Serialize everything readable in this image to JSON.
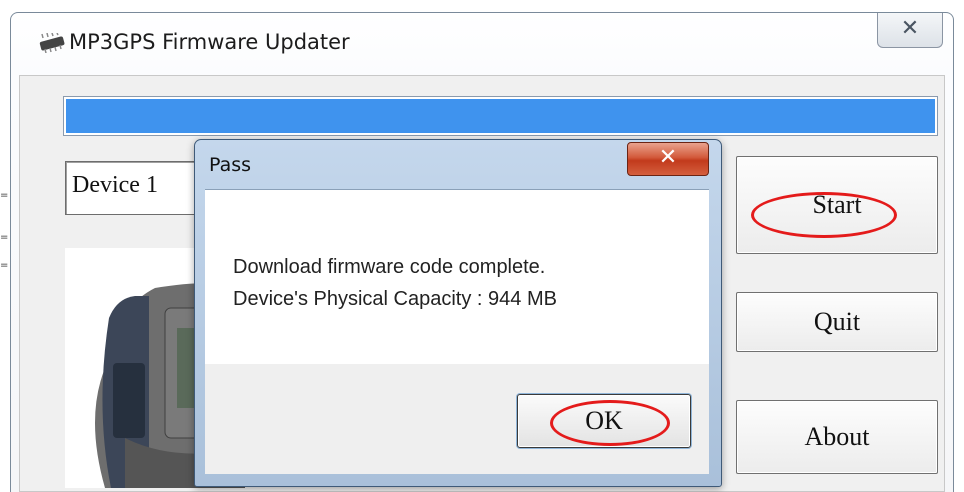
{
  "window": {
    "title": "MP3GPS Firmware Updater",
    "app_icon": "chip-icon",
    "close_glyph": "✕"
  },
  "main": {
    "progress_fraction": 1.0,
    "progress_color": "#3f93ee",
    "device_field_value": "Device  1",
    "start_label": "Start",
    "quit_label": "Quit",
    "about_label": "About"
  },
  "dialog": {
    "title": "Pass",
    "close_glyph": "✕",
    "message_line1": "Download firmware code complete.",
    "message_line2": "Device's Physical Capacity : 944 MB",
    "ok_label": "OK"
  },
  "annotations": {
    "highlight_color": "#e41b1b"
  }
}
